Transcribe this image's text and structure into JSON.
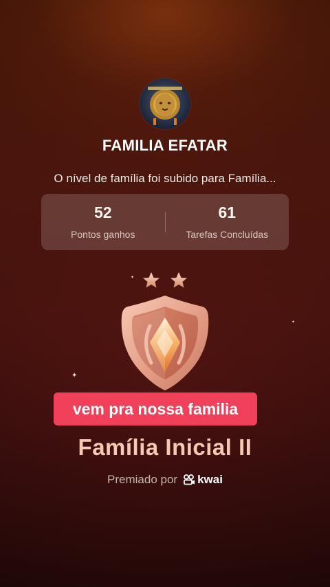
{
  "family": {
    "name": "FAMILIA EFATAR",
    "avatar_icon": "lion-emblem-icon"
  },
  "notification": {
    "message": "O nível de família foi subido para Família..."
  },
  "stats": [
    {
      "value": "52",
      "label": "Pontos ganhos"
    },
    {
      "value": "61",
      "label": "Tarefas Concluídas"
    }
  ],
  "badge": {
    "icon": "shield-badge-icon",
    "stars": 2,
    "level_title": "Família Inicial II"
  },
  "caption": {
    "text": "vem pra nossa familia",
    "color": "#f0405a"
  },
  "footer": {
    "awarded_by_label": "Premiado por",
    "brand_name": "kwai",
    "brand_icon": "kwai-logo-icon"
  },
  "colors": {
    "title_accent": "#f6c9b3",
    "badge_primary": "#e9a892",
    "badge_gem": "#f39a4a"
  }
}
